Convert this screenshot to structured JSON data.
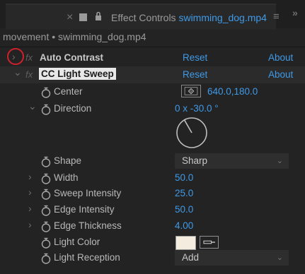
{
  "tab": {
    "prefix": "Effect Controls",
    "file": "swimming_dog.mp4"
  },
  "path": "movement • swimming_dog.mp4",
  "effects": [
    {
      "name": "Auto Contrast",
      "reset": "Reset",
      "about": "About"
    },
    {
      "name": "CC Light Sweep",
      "reset": "Reset",
      "about": "About"
    }
  ],
  "properties": {
    "center": {
      "label": "Center",
      "value": "640.0,180.0"
    },
    "direction": {
      "label": "Direction",
      "value": "0 x -30.0 °"
    },
    "shape": {
      "label": "Shape",
      "value": "Sharp"
    },
    "width": {
      "label": "Width",
      "value": "50.0"
    },
    "sweep_intensity": {
      "label": "Sweep Intensity",
      "value": "25.0"
    },
    "edge_intensity": {
      "label": "Edge Intensity",
      "value": "50.0"
    },
    "edge_thickness": {
      "label": "Edge Thickness",
      "value": "4.00"
    },
    "light_color": {
      "label": "Light Color",
      "color": "#f3ecdf"
    },
    "light_reception": {
      "label": "Light Reception",
      "value": "Add"
    }
  },
  "icons": {
    "fx": "fx",
    "twirl_closed": "›",
    "twirl_open": "⌄",
    "tab_menu": "≡",
    "panel_more": "»"
  },
  "colors": {
    "accent": "#3f9ae8",
    "highlight_circle": "#d0202c"
  }
}
